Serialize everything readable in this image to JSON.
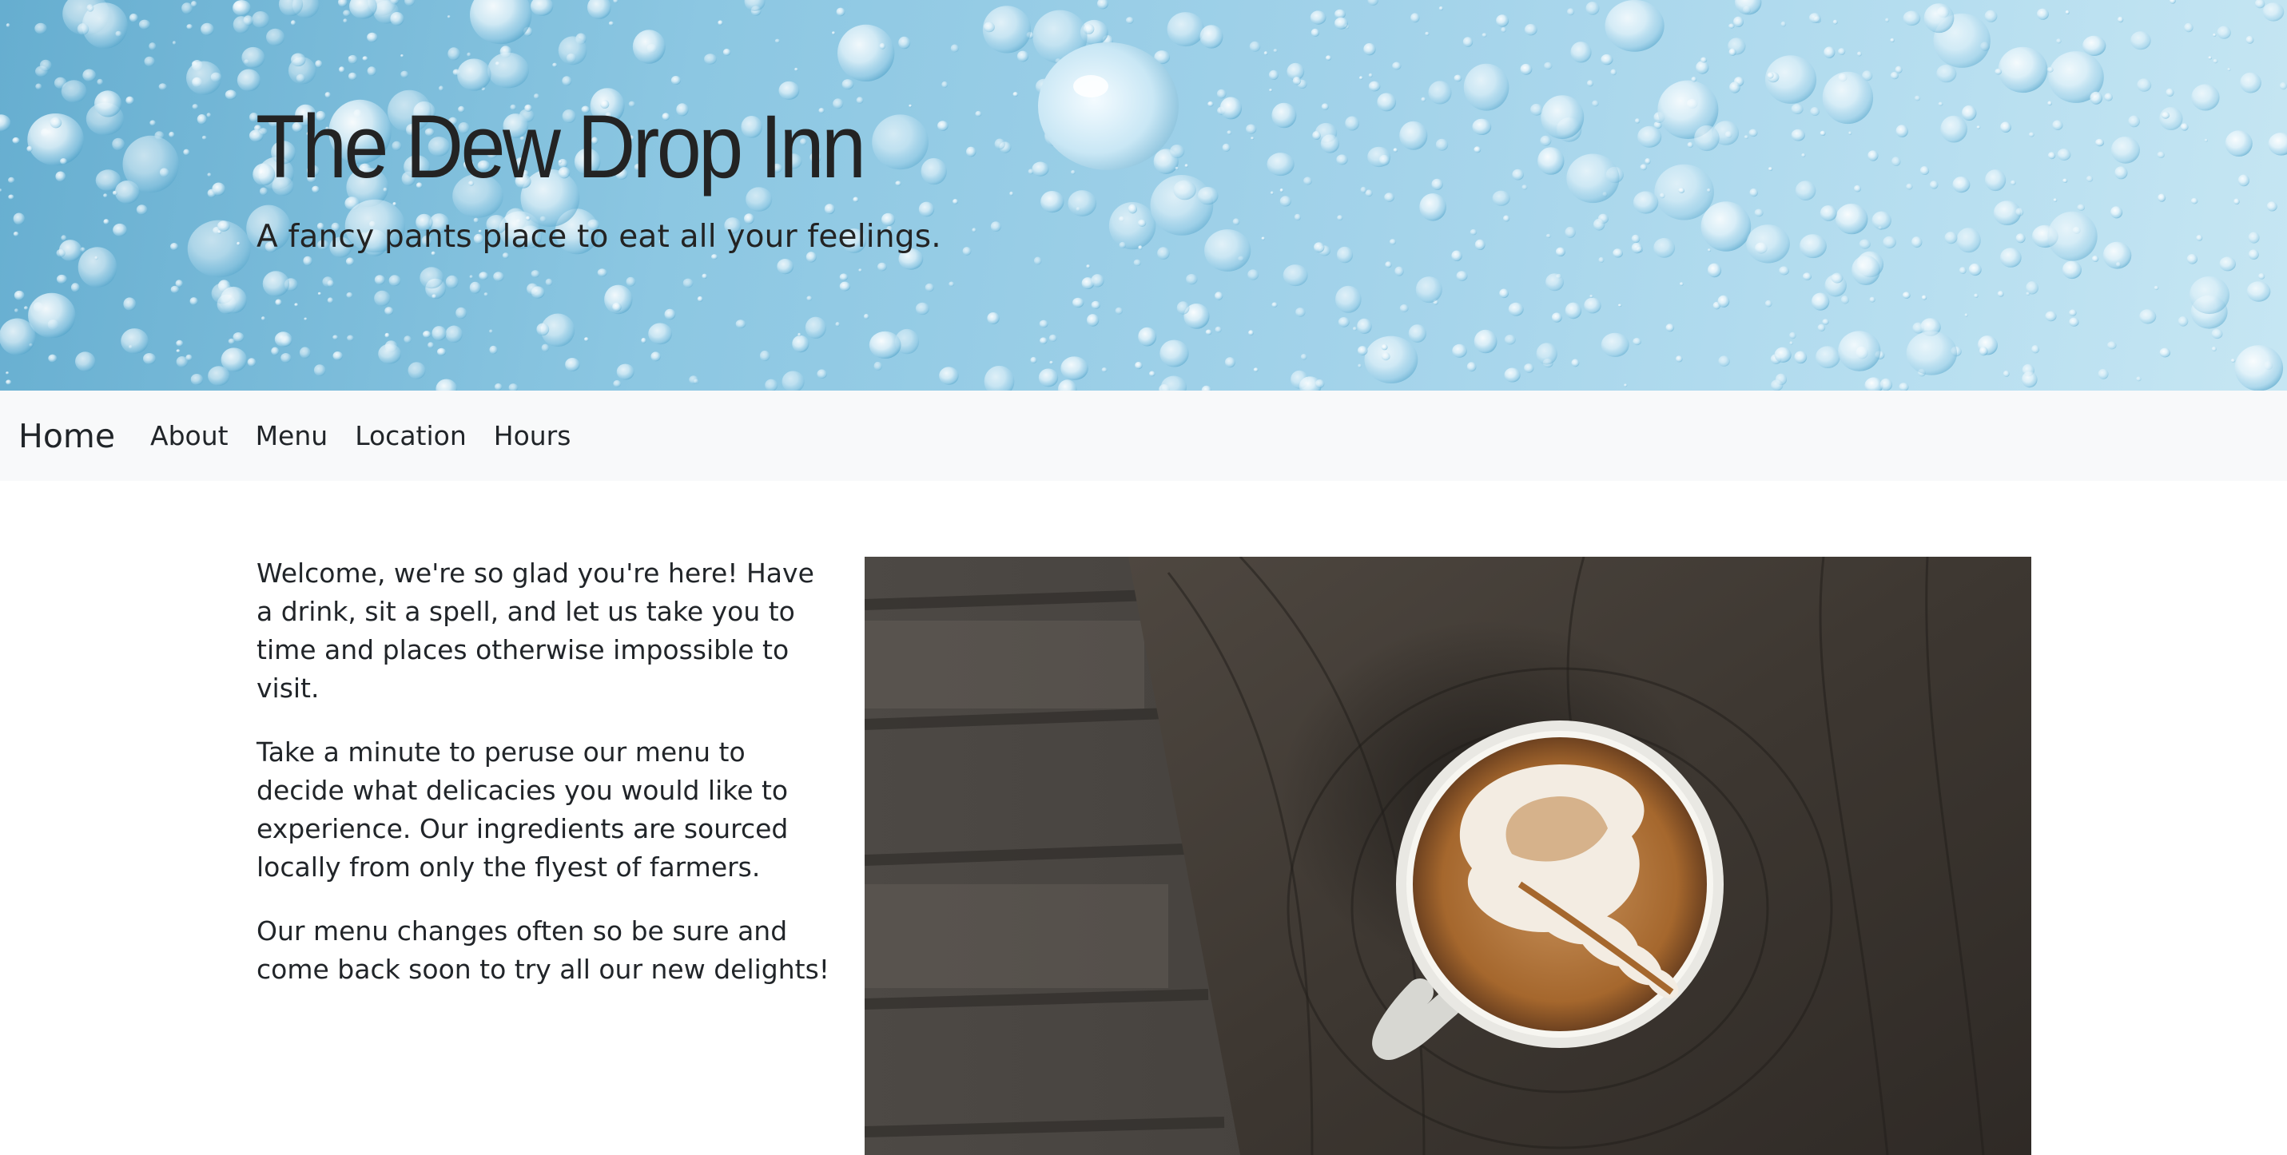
{
  "hero": {
    "title": "The Dew Drop Inn",
    "subtitle": "A fancy pants place to eat all your feelings.",
    "background_image": "water-droplets-image"
  },
  "navbar": {
    "brand": "Home",
    "links": [
      "About",
      "Menu",
      "Location",
      "Hours"
    ],
    "background_color": "#f8f9fa"
  },
  "main": {
    "paragraphs": [
      "Welcome, we're so glad you're here! Have a drink, sit a spell, and let us take you to time and places otherwise impossible to visit.",
      "Take a minute to peruse our menu to decide what delicacies you would like to experience. Our ingredients are sourced locally from only the flyest of farmers.",
      "Our menu changes often so be sure and come back soon to try all our new delights!"
    ],
    "image": "latte-on-wooden-table-image"
  },
  "colors": {
    "hero_blue": "#8cc7e2",
    "text": "#212529",
    "page_background": "#ffffff"
  }
}
